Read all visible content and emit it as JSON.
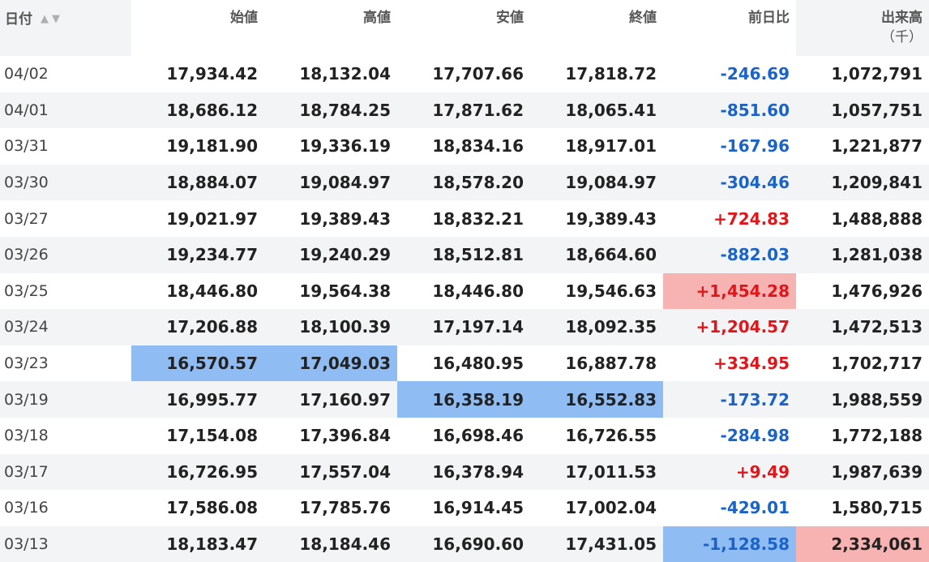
{
  "headers": {
    "date": "日付",
    "open": "始値",
    "high": "高値",
    "low": "安値",
    "close": "終値",
    "change": "前日比",
    "volume": "出来高",
    "volume_unit": "（千）",
    "sort_icons": "▲▼"
  },
  "colors": {
    "negative": "#1a63c9",
    "positive": "#e0161b",
    "highlight_blue": "#8fbcf2",
    "highlight_red": "#f7b2b2",
    "stripe": "#f3f4f6"
  },
  "rows": [
    {
      "date": "04/02",
      "open": "17,934.42",
      "high": "18,132.04",
      "low": "17,707.66",
      "close": "17,818.72",
      "change": "-246.69",
      "volume": "1,072,791"
    },
    {
      "date": "04/01",
      "open": "18,686.12",
      "high": "18,784.25",
      "low": "17,871.62",
      "close": "18,065.41",
      "change": "-851.60",
      "volume": "1,057,751"
    },
    {
      "date": "03/31",
      "open": "19,181.90",
      "high": "19,336.19",
      "low": "18,834.16",
      "close": "18,917.01",
      "change": "-167.96",
      "volume": "1,221,877"
    },
    {
      "date": "03/30",
      "open": "18,884.07",
      "high": "19,084.97",
      "low": "18,578.20",
      "close": "19,084.97",
      "change": "-304.46",
      "volume": "1,209,841"
    },
    {
      "date": "03/27",
      "open": "19,021.97",
      "high": "19,389.43",
      "low": "18,832.21",
      "close": "19,389.43",
      "change": "+724.83",
      "volume": "1,488,888"
    },
    {
      "date": "03/26",
      "open": "19,234.77",
      "high": "19,240.29",
      "low": "18,512.81",
      "close": "18,664.60",
      "change": "-882.03",
      "volume": "1,281,038"
    },
    {
      "date": "03/25",
      "open": "18,446.80",
      "high": "19,564.38",
      "low": "18,446.80",
      "close": "19,546.63",
      "change": "+1,454.28",
      "volume": "1,476,926"
    },
    {
      "date": "03/24",
      "open": "17,206.88",
      "high": "18,100.39",
      "low": "17,197.14",
      "close": "18,092.35",
      "change": "+1,204.57",
      "volume": "1,472,513"
    },
    {
      "date": "03/23",
      "open": "16,570.57",
      "high": "17,049.03",
      "low": "16,480.95",
      "close": "16,887.78",
      "change": "+334.95",
      "volume": "1,702,717"
    },
    {
      "date": "03/19",
      "open": "16,995.77",
      "high": "17,160.97",
      "low": "16,358.19",
      "close": "16,552.83",
      "change": "-173.72",
      "volume": "1,988,559"
    },
    {
      "date": "03/18",
      "open": "17,154.08",
      "high": "17,396.84",
      "low": "16,698.46",
      "close": "16,726.55",
      "change": "-284.98",
      "volume": "1,772,188"
    },
    {
      "date": "03/17",
      "open": "16,726.95",
      "high": "17,557.04",
      "low": "16,378.94",
      "close": "17,011.53",
      "change": "+9.49",
      "volume": "1,987,639"
    },
    {
      "date": "03/16",
      "open": "17,586.08",
      "high": "17,785.76",
      "low": "16,914.45",
      "close": "17,002.04",
      "change": "-429.01",
      "volume": "1,580,715"
    },
    {
      "date": "03/13",
      "open": "18,183.47",
      "high": "18,184.46",
      "low": "16,690.60",
      "close": "17,431.05",
      "change": "-1,128.58",
      "volume": "2,334,061"
    }
  ]
}
